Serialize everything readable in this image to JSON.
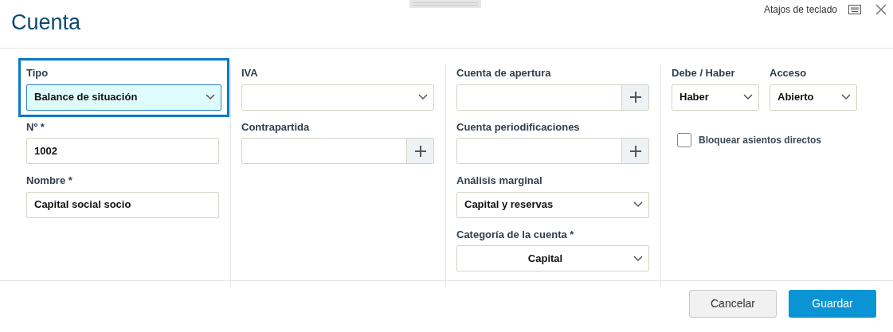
{
  "window": {
    "title": "Cuenta",
    "shortcuts_link": "Atajos de teclado"
  },
  "columns": [
    [
      [
        {
          "kind": "select",
          "label": "Tipo",
          "value": "Balance de situación",
          "focused": true
        }
      ],
      [
        {
          "kind": "text",
          "label": "Nº *",
          "value": "1002",
          "focused": false
        }
      ],
      [
        {
          "kind": "text",
          "label": "Nombre *",
          "value": "Capital social socio",
          "focused": false
        }
      ]
    ],
    [
      [
        {
          "kind": "select",
          "label": "IVA",
          "focused": false
        }
      ],
      [
        {
          "kind": "lookup",
          "label": "Contrapartida",
          "focused": false
        }
      ]
    ],
    [
      [
        {
          "kind": "lookup",
          "label": "Cuenta de apertura",
          "focused": false
        }
      ],
      [
        {
          "kind": "lookup",
          "label": "Cuenta periodificaciones",
          "focused": false
        }
      ],
      [
        {
          "kind": "select",
          "label": "Análisis marginal",
          "value": "Capital y reservas",
          "focused": false
        }
      ],
      [
        {
          "kind": "select",
          "label": "Categoría de la cuenta *",
          "value": "Capital",
          "centered": true,
          "focused": false
        }
      ]
    ],
    [
      [
        {
          "kind": "select",
          "label": "Debe / Haber",
          "value": "Haber",
          "focused": false
        },
        {
          "kind": "select",
          "label": "Acceso",
          "value": "Abierto",
          "focused": false
        }
      ],
      [
        {
          "kind": "checkbox",
          "label": "Bloquear asientos directos",
          "checked": false
        }
      ]
    ]
  ],
  "buttons": [
    {
      "label": "Cancelar",
      "kind": "secondary"
    },
    {
      "label": "Guardar",
      "kind": "primary"
    }
  ]
}
